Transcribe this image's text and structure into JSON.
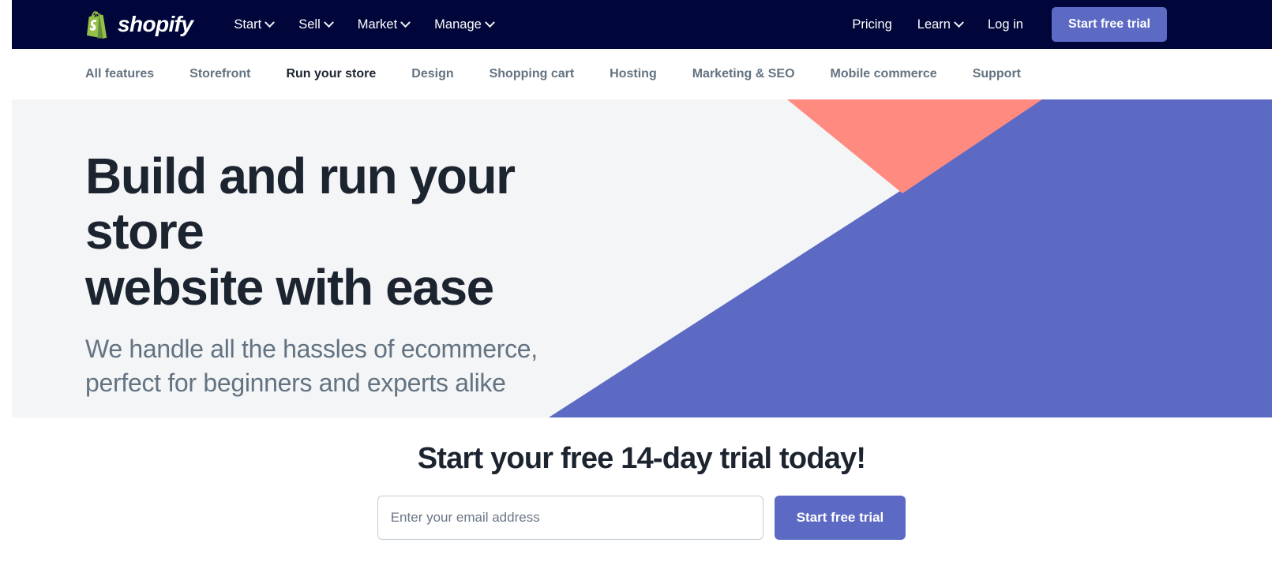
{
  "brand": {
    "name": "shopify",
    "logo_icon": "shopify-bag-icon",
    "bag_color": "#95bf47",
    "bag_dark": "#5e8e3e"
  },
  "colors": {
    "header_bg": "#000639",
    "accent_purple": "#5c6ac4",
    "hero_bg": "#f4f5f7",
    "coral": "#ff8a80",
    "heading": "#1c2430",
    "muted": "#637381"
  },
  "header": {
    "nav": [
      {
        "label": "Start",
        "has_caret": true
      },
      {
        "label": "Sell",
        "has_caret": true
      },
      {
        "label": "Market",
        "has_caret": true
      },
      {
        "label": "Manage",
        "has_caret": true
      }
    ],
    "right_nav": [
      {
        "label": "Pricing",
        "has_caret": false
      },
      {
        "label": "Learn",
        "has_caret": true
      },
      {
        "label": "Log in",
        "has_caret": false
      }
    ],
    "cta_label": "Start free trial"
  },
  "subnav": {
    "items": [
      {
        "label": "All features",
        "active": false
      },
      {
        "label": "Storefront",
        "active": false
      },
      {
        "label": "Run your store",
        "active": true
      },
      {
        "label": "Design",
        "active": false
      },
      {
        "label": "Shopping cart",
        "active": false
      },
      {
        "label": "Hosting",
        "active": false
      },
      {
        "label": "Marketing & SEO",
        "active": false
      },
      {
        "label": "Mobile commerce",
        "active": false
      },
      {
        "label": "Support",
        "active": false
      }
    ]
  },
  "hero": {
    "title_line1": "Build and run your store",
    "title_line2": "website with ease",
    "subtitle_line1": "We handle all the hassles of ecommerce,",
    "subtitle_line2": "perfect for beginners and experts alike"
  },
  "trial": {
    "title": "Start your free 14-day trial today!",
    "email_placeholder": "Enter your email address",
    "email_value": "",
    "button_label": "Start free trial"
  }
}
